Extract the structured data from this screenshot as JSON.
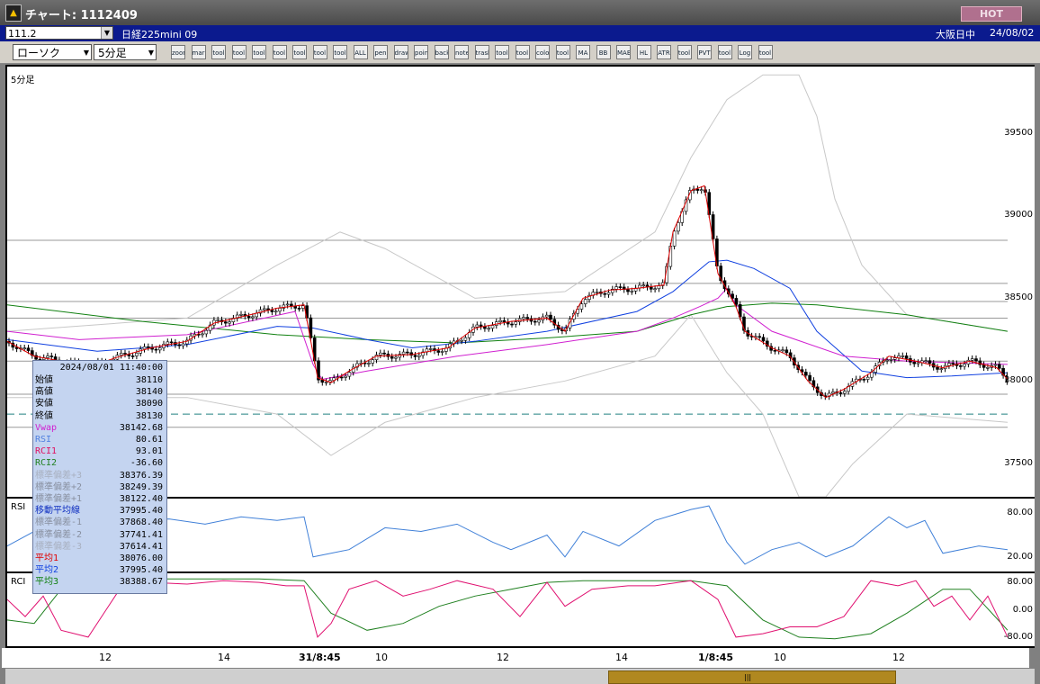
{
  "window": {
    "title": "チャート: 1112409",
    "hot_label": "HOT"
  },
  "infobar": {
    "code": "111.2",
    "name": "日経225mini 09",
    "session": "大阪日中",
    "date": "24/08/02"
  },
  "toolbar": {
    "chart_type": "ローソク",
    "interval": "5分足",
    "buttons": [
      "zoom",
      "mark",
      "tool",
      "tool",
      "tool",
      "tool",
      "tool",
      "tool",
      "tool",
      "ALL",
      "pen",
      "draw",
      "pointer",
      "back",
      "note",
      "trash",
      "tool",
      "tool",
      "color",
      "tool",
      "MA",
      "BB",
      "MAE",
      "HL",
      "ATR",
      "tool",
      "PVT",
      "tool",
      "Log",
      "tool"
    ]
  },
  "main_panel": {
    "label": "5分足",
    "y_ticks": [
      {
        "label": "39500",
        "v": 39500
      },
      {
        "label": "39000",
        "v": 39000
      },
      {
        "label": "38500",
        "v": 38500
      },
      {
        "label": "38000",
        "v": 38000
      },
      {
        "label": "37500",
        "v": 37500
      }
    ]
  },
  "rsi_panel": {
    "label": "RSI",
    "y_ticks": [
      {
        "label": "80.00",
        "v": 80
      },
      {
        "label": "20.00",
        "v": 20
      }
    ]
  },
  "rci_panel": {
    "label": "RCI",
    "y_ticks": [
      {
        "label": "80.00",
        "v": 80
      },
      {
        "label": "0.00",
        "v": 0
      },
      {
        "label": "-80.00",
        "v": -80
      }
    ]
  },
  "time_axis": [
    {
      "label": "12",
      "pos": 120
    },
    {
      "label": "14",
      "pos": 252
    },
    {
      "label": "31/8:45",
      "pos": 342,
      "bold": true
    },
    {
      "label": "10",
      "pos": 427
    },
    {
      "label": "12",
      "pos": 562
    },
    {
      "label": "14",
      "pos": 694
    },
    {
      "label": "1/8:45",
      "pos": 786,
      "bold": true
    },
    {
      "label": "10",
      "pos": 870
    },
    {
      "label": "12",
      "pos": 1002
    }
  ],
  "databox": {
    "datetime": "2024/08/01  11:40:00",
    "rows": [
      {
        "k": "始値",
        "v": "38110",
        "c": "#000"
      },
      {
        "k": "高値",
        "v": "38140",
        "c": "#000"
      },
      {
        "k": "安値",
        "v": "38090",
        "c": "#000"
      },
      {
        "k": "終値",
        "v": "38130",
        "c": "#000"
      },
      {
        "k": "Vwap",
        "v": "38142.68",
        "c": "#d020d0"
      },
      {
        "k": "RSI",
        "v": "80.61",
        "c": "#5080e0"
      },
      {
        "k": "RCI1",
        "v": "93.01",
        "c": "#e01060"
      },
      {
        "k": "RCI2",
        "v": "-36.60",
        "c": "#208020"
      },
      {
        "k": "標準偏差+3",
        "v": "38376.39",
        "c": "#a8b0c0"
      },
      {
        "k": "標準偏差+2",
        "v": "38249.39",
        "c": "#8890a0"
      },
      {
        "k": "標準偏差+1",
        "v": "38122.40",
        "c": "#8890a0"
      },
      {
        "k": "移動平均線",
        "v": "37995.40",
        "c": "#1030c0"
      },
      {
        "k": "標準偏差-1",
        "v": "37868.40",
        "c": "#8890a0"
      },
      {
        "k": "標準偏差-2",
        "v": "37741.41",
        "c": "#8890a0"
      },
      {
        "k": "標準偏差-3",
        "v": "37614.41",
        "c": "#a8b0c0"
      },
      {
        "k": "平均1",
        "v": "38076.00",
        "c": "#e00000"
      },
      {
        "k": "平均2",
        "v": "37995.40",
        "c": "#1040e0"
      },
      {
        "k": "平均3",
        "v": "38388.67",
        "c": "#108010"
      }
    ]
  },
  "colors": {
    "vwap": "#d020d0",
    "rsi": "#4080d8",
    "rci1": "#e01070",
    "rci2": "#208020",
    "ma1": "#e00000",
    "ma2": "#1040e0",
    "ma3": "#108010",
    "bb": "#b0b0b0"
  },
  "chart_data": {
    "type": "candlestick",
    "ylim": [
      37300,
      39900
    ],
    "close_path": [
      [
        0,
        38240
      ],
      [
        30,
        38150
      ],
      [
        60,
        38120
      ],
      [
        90,
        38080
      ],
      [
        120,
        38140
      ],
      [
        160,
        38200
      ],
      [
        200,
        38240
      ],
      [
        230,
        38350
      ],
      [
        270,
        38400
      ],
      [
        300,
        38440
      ],
      [
        330,
        38460
      ],
      [
        345,
        38020
      ],
      [
        360,
        37990
      ],
      [
        380,
        38060
      ],
      [
        410,
        38150
      ],
      [
        450,
        38160
      ],
      [
        490,
        38200
      ],
      [
        520,
        38320
      ],
      [
        560,
        38360
      ],
      [
        600,
        38380
      ],
      [
        620,
        38300
      ],
      [
        640,
        38500
      ],
      [
        670,
        38550
      ],
      [
        700,
        38560
      ],
      [
        730,
        38580
      ],
      [
        740,
        38900
      ],
      [
        760,
        39150
      ],
      [
        775,
        39180
      ],
      [
        790,
        38650
      ],
      [
        810,
        38450
      ],
      [
        820,
        38300
      ],
      [
        850,
        38200
      ],
      [
        870,
        38150
      ],
      [
        890,
        38000
      ],
      [
        910,
        37900
      ],
      [
        930,
        37950
      ],
      [
        960,
        38050
      ],
      [
        980,
        38150
      ],
      [
        1010,
        38120
      ],
      [
        1040,
        38080
      ],
      [
        1070,
        38120
      ],
      [
        1100,
        38080
      ],
      [
        1112,
        38010
      ]
    ],
    "vwap": [
      [
        0,
        38300
      ],
      [
        80,
        38250
      ],
      [
        200,
        38280
      ],
      [
        320,
        38420
      ],
      [
        340,
        38100
      ],
      [
        350,
        38010
      ],
      [
        400,
        38060
      ],
      [
        500,
        38150
      ],
      [
        600,
        38220
      ],
      [
        700,
        38300
      ],
      [
        740,
        38380
      ],
      [
        770,
        38450
      ],
      [
        790,
        38500
      ],
      [
        800,
        38560
      ],
      [
        810,
        38460
      ],
      [
        850,
        38300
      ],
      [
        930,
        38150
      ],
      [
        1000,
        38120
      ],
      [
        1112,
        38100
      ]
    ],
    "ma2": [
      [
        0,
        38250
      ],
      [
        100,
        38180
      ],
      [
        200,
        38220
      ],
      [
        300,
        38330
      ],
      [
        340,
        38320
      ],
      [
        400,
        38250
      ],
      [
        450,
        38200
      ],
      [
        520,
        38240
      ],
      [
        600,
        38300
      ],
      [
        700,
        38420
      ],
      [
        740,
        38540
      ],
      [
        760,
        38630
      ],
      [
        780,
        38720
      ],
      [
        800,
        38730
      ],
      [
        830,
        38680
      ],
      [
        870,
        38560
      ],
      [
        900,
        38300
      ],
      [
        950,
        38060
      ],
      [
        1000,
        38020
      ],
      [
        1050,
        38030
      ],
      [
        1112,
        38050
      ]
    ],
    "ma3": [
      [
        0,
        38460
      ],
      [
        150,
        38360
      ],
      [
        300,
        38280
      ],
      [
        400,
        38250
      ],
      [
        500,
        38230
      ],
      [
        600,
        38260
      ],
      [
        700,
        38300
      ],
      [
        760,
        38400
      ],
      [
        800,
        38450
      ],
      [
        850,
        38470
      ],
      [
        900,
        38460
      ],
      [
        1000,
        38400
      ],
      [
        1112,
        38300
      ]
    ],
    "bb_outer_up": [
      [
        0,
        38300
      ],
      [
        200,
        38380
      ],
      [
        300,
        38700
      ],
      [
        370,
        38900
      ],
      [
        420,
        38800
      ],
      [
        520,
        38500
      ],
      [
        620,
        38540
      ],
      [
        720,
        38900
      ],
      [
        760,
        39350
      ],
      [
        800,
        39700
      ],
      [
        840,
        39850
      ],
      [
        880,
        39850
      ],
      [
        900,
        39600
      ],
      [
        920,
        39100
      ],
      [
        950,
        38700
      ],
      [
        1000,
        38400
      ],
      [
        1112,
        38300
      ]
    ],
    "bb_outer_dn": [
      [
        0,
        37900
      ],
      [
        200,
        37900
      ],
      [
        300,
        37800
      ],
      [
        360,
        37550
      ],
      [
        420,
        37750
      ],
      [
        520,
        37900
      ],
      [
        620,
        38000
      ],
      [
        720,
        38150
      ],
      [
        760,
        38400
      ],
      [
        800,
        38050
      ],
      [
        840,
        37800
      ],
      [
        880,
        37300
      ],
      [
        910,
        37300
      ],
      [
        940,
        37500
      ],
      [
        1000,
        37800
      ],
      [
        1112,
        37750
      ]
    ],
    "hlines": [
      38850,
      38590,
      38480,
      38380,
      38120,
      37920,
      37720
    ],
    "dashed_line": 37800,
    "rsi": [
      [
        0,
        35
      ],
      [
        30,
        55
      ],
      [
        60,
        45
      ],
      [
        100,
        60
      ],
      [
        130,
        70
      ],
      [
        180,
        72
      ],
      [
        220,
        65
      ],
      [
        260,
        75
      ],
      [
        300,
        70
      ],
      [
        330,
        75
      ],
      [
        340,
        20
      ],
      [
        380,
        30
      ],
      [
        420,
        60
      ],
      [
        460,
        55
      ],
      [
        500,
        65
      ],
      [
        540,
        40
      ],
      [
        560,
        30
      ],
      [
        600,
        50
      ],
      [
        620,
        20
      ],
      [
        640,
        55
      ],
      [
        680,
        35
      ],
      [
        720,
        70
      ],
      [
        760,
        85
      ],
      [
        780,
        90
      ],
      [
        800,
        40
      ],
      [
        820,
        10
      ],
      [
        850,
        30
      ],
      [
        880,
        40
      ],
      [
        910,
        20
      ],
      [
        940,
        35
      ],
      [
        980,
        75
      ],
      [
        1000,
        60
      ],
      [
        1020,
        70
      ],
      [
        1040,
        25
      ],
      [
        1080,
        35
      ],
      [
        1112,
        30
      ]
    ],
    "rci1": [
      [
        0,
        30
      ],
      [
        20,
        -20
      ],
      [
        40,
        40
      ],
      [
        60,
        -60
      ],
      [
        90,
        -80
      ],
      [
        110,
        0
      ],
      [
        130,
        80
      ],
      [
        160,
        80
      ],
      [
        200,
        75
      ],
      [
        240,
        85
      ],
      [
        280,
        80
      ],
      [
        310,
        70
      ],
      [
        330,
        70
      ],
      [
        345,
        -80
      ],
      [
        360,
        -40
      ],
      [
        380,
        60
      ],
      [
        410,
        85
      ],
      [
        440,
        40
      ],
      [
        470,
        60
      ],
      [
        500,
        85
      ],
      [
        540,
        60
      ],
      [
        570,
        -20
      ],
      [
        600,
        80
      ],
      [
        620,
        10
      ],
      [
        650,
        60
      ],
      [
        690,
        70
      ],
      [
        720,
        70
      ],
      [
        760,
        85
      ],
      [
        790,
        30
      ],
      [
        810,
        -80
      ],
      [
        840,
        -70
      ],
      [
        870,
        -50
      ],
      [
        900,
        -50
      ],
      [
        930,
        -20
      ],
      [
        960,
        85
      ],
      [
        990,
        70
      ],
      [
        1010,
        85
      ],
      [
        1030,
        10
      ],
      [
        1050,
        40
      ],
      [
        1070,
        -30
      ],
      [
        1090,
        40
      ],
      [
        1112,
        -80
      ]
    ],
    "rci2": [
      [
        0,
        -30
      ],
      [
        30,
        -40
      ],
      [
        60,
        60
      ],
      [
        100,
        80
      ],
      [
        160,
        90
      ],
      [
        220,
        90
      ],
      [
        280,
        90
      ],
      [
        330,
        85
      ],
      [
        360,
        -10
      ],
      [
        400,
        -60
      ],
      [
        440,
        -40
      ],
      [
        480,
        10
      ],
      [
        520,
        40
      ],
      [
        560,
        60
      ],
      [
        600,
        80
      ],
      [
        640,
        85
      ],
      [
        700,
        85
      ],
      [
        760,
        85
      ],
      [
        800,
        70
      ],
      [
        840,
        -30
      ],
      [
        880,
        -80
      ],
      [
        920,
        -85
      ],
      [
        960,
        -70
      ],
      [
        1000,
        -10
      ],
      [
        1040,
        60
      ],
      [
        1070,
        60
      ],
      [
        1112,
        -60
      ]
    ]
  }
}
